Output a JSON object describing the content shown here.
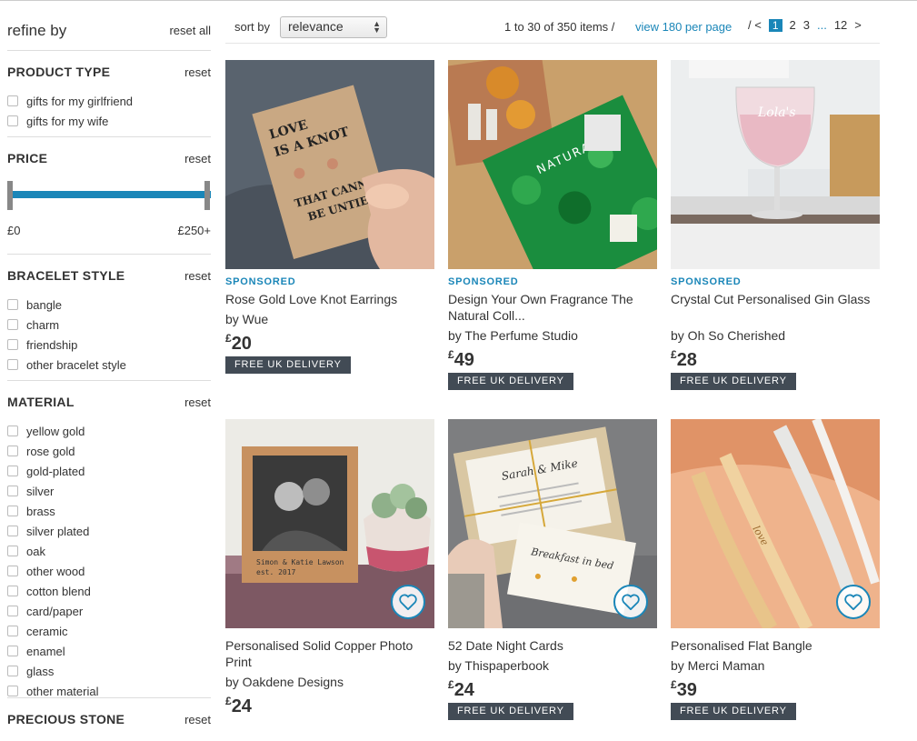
{
  "sidebar": {
    "title": "refine by",
    "reset_all": "reset all",
    "reset_label": "reset",
    "product_type": {
      "title": "PRODUCT TYPE",
      "options": [
        "gifts for my girlfriend",
        "gifts for my wife"
      ]
    },
    "price": {
      "title": "PRICE",
      "min_label": "£0",
      "max_label": "£250+"
    },
    "bracelet_style": {
      "title": "BRACELET STYLE",
      "options": [
        "bangle",
        "charm",
        "friendship",
        "other bracelet style"
      ]
    },
    "material": {
      "title": "MATERIAL",
      "options": [
        "yellow gold",
        "rose gold",
        "gold-plated",
        "silver",
        "brass",
        "silver plated",
        "oak",
        "other wood",
        "cotton blend",
        "card/paper",
        "ceramic",
        "enamel",
        "glass",
        "other material"
      ]
    },
    "precious_stone": {
      "title": "PRECIOUS STONE"
    }
  },
  "toolbar": {
    "sort_label": "sort by",
    "sort_value": "relevance",
    "items_text": "1 to 30 of 350 items /",
    "per_page": "view 180 per page",
    "pagination": {
      "prev": "/ <",
      "current": "1",
      "pages": [
        "2",
        "3"
      ],
      "dots": "...",
      "last": "12",
      "next": ">"
    }
  },
  "products": [
    {
      "sponsored": "SPONSORED",
      "name": "Rose Gold Love Knot Earrings",
      "seller": "by Wue",
      "currency": "£",
      "price": "20",
      "badge": "FREE UK DELIVERY"
    },
    {
      "sponsored": "SPONSORED",
      "name": "Design Your Own Fragrance The Natural Coll...",
      "seller": "by The Perfume Studio",
      "currency": "£",
      "price": "49",
      "badge": "FREE UK DELIVERY"
    },
    {
      "sponsored": "SPONSORED",
      "name": "Crystal Cut Personalised Gin Glass",
      "seller": "by Oh So Cherished",
      "currency": "£",
      "price": "28",
      "badge": "FREE UK DELIVERY"
    },
    {
      "sponsored": "",
      "name": "Personalised Solid Copper Photo Print",
      "seller": "by Oakdene Designs",
      "currency": "£",
      "price": "24",
      "badge": ""
    },
    {
      "sponsored": "",
      "name": "52 Date Night Cards",
      "seller": "by Thispaperbook",
      "currency": "£",
      "price": "24",
      "badge": "FREE UK DELIVERY"
    },
    {
      "sponsored": "",
      "name": "Personalised Flat Bangle",
      "seller": "by Merci Maman",
      "currency": "£",
      "price": "39",
      "badge": "FREE UK DELIVERY"
    }
  ],
  "image_text": {
    "earring_card": [
      "LOVE",
      "IS A KNOT",
      "THAT CANNOT",
      "BE UNTIED"
    ],
    "fragrance_box": "NATURAL",
    "glass": "Lola's",
    "photo_caption": [
      "Simon & Katie Lawson",
      "est. 2017"
    ],
    "cards_names": "Sarah & Mike",
    "cards_title": "Breakfast in bed",
    "bangle_text": "love"
  },
  "colors": {
    "accent": "#1a86b8",
    "badge_bg": "#424b55"
  }
}
